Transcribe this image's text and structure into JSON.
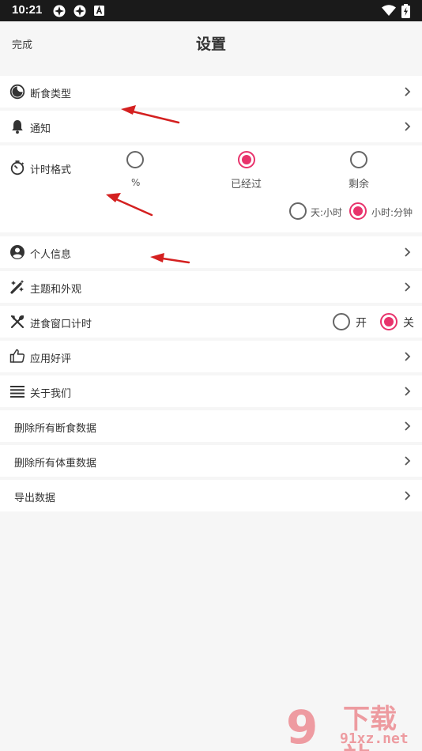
{
  "status_bar": {
    "time": "10:21",
    "icons": [
      "app-icon-1",
      "app-icon-2",
      "a-notification-icon",
      "wifi-icon",
      "battery-charging-icon"
    ]
  },
  "header": {
    "done_label": "完成",
    "title": "设置"
  },
  "settings": {
    "fasting_type": {
      "label": "断食类型",
      "icon": "moon-icon"
    },
    "notifications": {
      "label": "通知",
      "icon": "bell-icon"
    },
    "timer_format": {
      "label": "计时格式",
      "icon": "stopwatch-icon",
      "options": [
        {
          "label": "%",
          "selected": false
        },
        {
          "label": "已经过",
          "selected": true
        },
        {
          "label": "剩余",
          "selected": false
        }
      ],
      "unit_options": [
        {
          "label": "天:小时",
          "selected": false
        },
        {
          "label": "小时:分钟",
          "selected": true
        }
      ]
    },
    "personal_info": {
      "label": "个人信息",
      "icon": "account-circle-icon"
    },
    "theme": {
      "label": "主题和外观",
      "icon": "magic-wand-icon"
    },
    "eating_window": {
      "label": "进食窗口计时",
      "icon": "utensils-icon",
      "on_label": "开",
      "off_label": "关",
      "state": "off"
    },
    "rate_app": {
      "label": "应用好评",
      "icon": "thumbs-up-icon"
    },
    "about": {
      "label": "关于我们",
      "icon": "menu-lines-icon"
    },
    "delete_fasting": {
      "label": "删除所有断食数据"
    },
    "delete_weight": {
      "label": "删除所有体重数据"
    },
    "export": {
      "label": "导出数据"
    }
  },
  "watermark": {
    "text": "下载站",
    "url_text": "91xz.net"
  },
  "colors": {
    "accent": "#e8336c",
    "annotation_arrow": "#d42020",
    "status_bar_bg": "#1a1a1a",
    "page_bg": "#f6f6f6"
  }
}
